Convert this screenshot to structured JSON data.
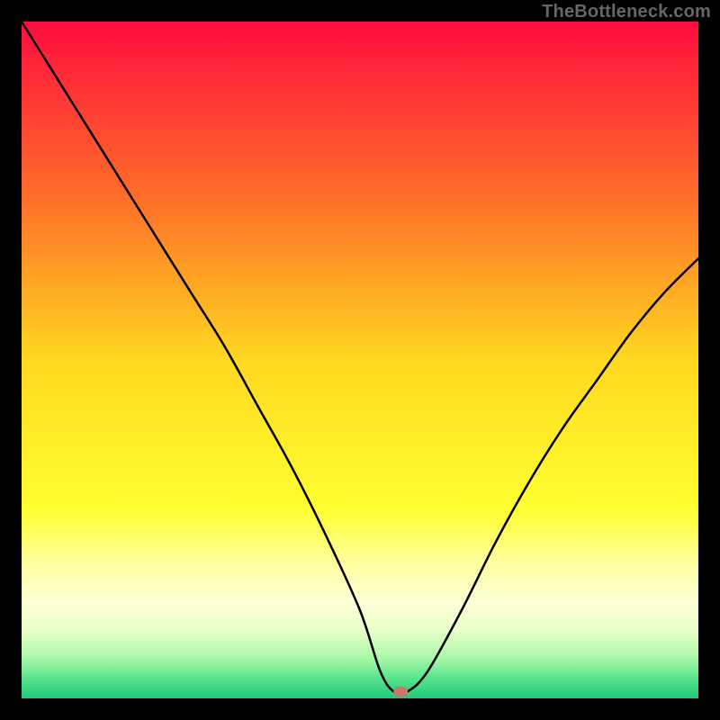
{
  "watermark": "TheBottleneck.com",
  "chart_data": {
    "type": "line",
    "title": "",
    "xlabel": "",
    "ylabel": "",
    "xlim": [
      0,
      100
    ],
    "ylim": [
      0,
      100
    ],
    "series": [
      {
        "name": "curve",
        "x": [
          0,
          5,
          10,
          15,
          20,
          25,
          30,
          35,
          40,
          45,
          50,
          53,
          55,
          57,
          60,
          65,
          70,
          75,
          80,
          85,
          90,
          95,
          100
        ],
        "y": [
          100,
          92,
          84,
          76,
          68,
          60,
          52,
          43,
          34,
          24,
          13,
          4,
          1,
          1,
          4,
          13,
          23,
          32,
          40,
          47,
          54,
          60,
          65
        ]
      }
    ],
    "marker": {
      "x": 56,
      "y": 1
    },
    "gradient_stops": [
      {
        "offset": 0.0,
        "color": "#ff0d3e"
      },
      {
        "offset": 0.25,
        "color": "#ff6a2a"
      },
      {
        "offset": 0.5,
        "color": "#ffd820"
      },
      {
        "offset": 0.72,
        "color": "#ffff30"
      },
      {
        "offset": 0.8,
        "color": "#ffffa0"
      },
      {
        "offset": 0.86,
        "color": "#fdffd8"
      },
      {
        "offset": 0.9,
        "color": "#e8ffc8"
      },
      {
        "offset": 0.94,
        "color": "#a8f8a8"
      },
      {
        "offset": 0.97,
        "color": "#5ae48e"
      },
      {
        "offset": 1.0,
        "color": "#1fc979"
      }
    ]
  }
}
